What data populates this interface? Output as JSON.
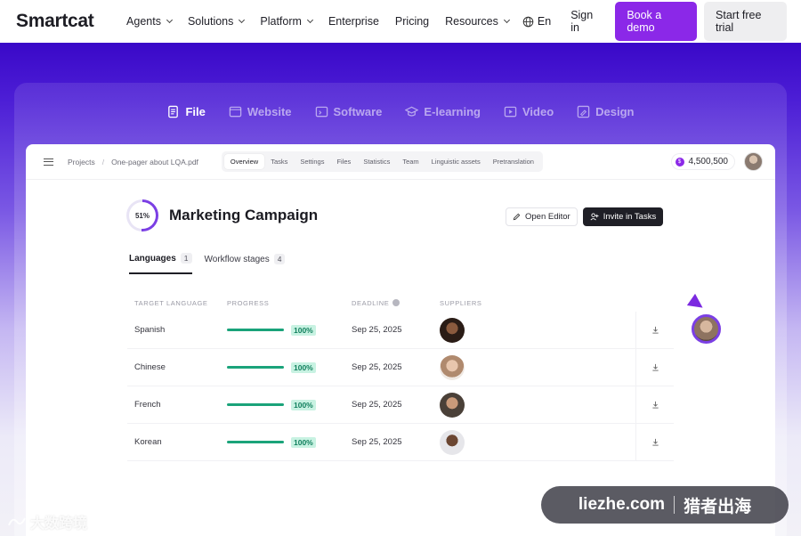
{
  "nav": {
    "logo": "Smartcat",
    "items": [
      {
        "label": "Agents",
        "dropdown": true
      },
      {
        "label": "Solutions",
        "dropdown": true
      },
      {
        "label": "Platform",
        "dropdown": true
      },
      {
        "label": "Enterprise",
        "dropdown": false
      },
      {
        "label": "Pricing",
        "dropdown": false
      },
      {
        "label": "Resources",
        "dropdown": true
      }
    ],
    "language": "En",
    "sign_in": "Sign in",
    "book_demo": "Book a demo",
    "free_trial": "Start free trial"
  },
  "feature_tabs": [
    {
      "label": "File",
      "icon": "file-icon",
      "active": true
    },
    {
      "label": "Website",
      "icon": "website-icon",
      "active": false
    },
    {
      "label": "Software",
      "icon": "software-icon",
      "active": false
    },
    {
      "label": "E-learning",
      "icon": "graduation-cap-icon",
      "active": false
    },
    {
      "label": "Video",
      "icon": "video-icon",
      "active": false
    },
    {
      "label": "Design",
      "icon": "design-icon",
      "active": false
    }
  ],
  "app": {
    "breadcrumb": [
      "Projects",
      "One-pager about LQA.pdf"
    ],
    "subtabs": [
      "Overview",
      "Tasks",
      "Settings",
      "Files",
      "Statistics",
      "Team",
      "Linguistic assets",
      "Pretranslation"
    ],
    "active_subtab": "Overview",
    "credits": "4,500,500",
    "project": {
      "progress_label": "51%",
      "progress_value": 0.51,
      "title": "Marketing Campaign",
      "open_editor": "Open Editor",
      "invite": "Invite in Tasks"
    },
    "lang_tabs": [
      {
        "label": "Languages",
        "count": "1",
        "active": true
      },
      {
        "label": "Workflow stages",
        "count": "4",
        "active": false
      }
    ],
    "table": {
      "headers": [
        "TARGET LANGUAGE",
        "PROGRESS",
        "DEADLINE",
        "SUPPLIERS"
      ],
      "rows": [
        {
          "language": "Spanish",
          "progress": "100%",
          "deadline": "Sep 25, 2025"
        },
        {
          "language": "Chinese",
          "progress": "100%",
          "deadline": "Sep 25, 2025"
        },
        {
          "language": "French",
          "progress": "100%",
          "deadline": "Sep 25, 2025"
        },
        {
          "language": "Korean",
          "progress": "100%",
          "deadline": "Sep 25, 2025"
        }
      ]
    }
  },
  "watermarks": {
    "left": "大数跨境",
    "right_domain": "liezhe.com",
    "right_name": "猎者出海"
  },
  "colors": {
    "brand_purple": "#8b28e8",
    "progress_green": "#1aa37a"
  }
}
